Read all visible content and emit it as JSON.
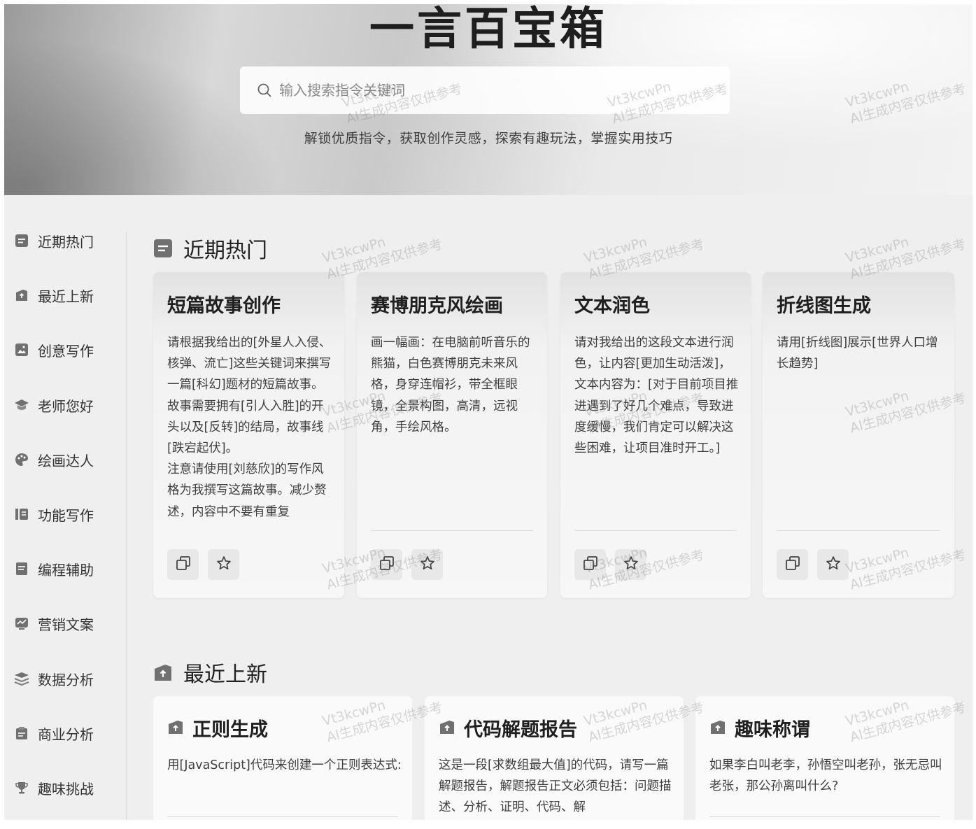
{
  "hero": {
    "title": "一言百宝箱",
    "search_placeholder": "输入搜索指令关键词",
    "tagline": "解锁优质指令，获取创作灵感，探索有趣玩法，掌握实用技巧"
  },
  "sidebar": {
    "items": [
      {
        "label": "近期热门",
        "icon": "list-icon"
      },
      {
        "label": "最近上新",
        "icon": "new-box-icon"
      },
      {
        "label": "创意写作",
        "icon": "image-icon"
      },
      {
        "label": "老师您好",
        "icon": "graduation-cap-icon"
      },
      {
        "label": "绘画达人",
        "icon": "palette-icon"
      },
      {
        "label": "功能写作",
        "icon": "document-icon"
      },
      {
        "label": "编程辅助",
        "icon": "code-list-icon"
      },
      {
        "label": "营销文案",
        "icon": "chart-screen-icon"
      },
      {
        "label": "数据分析",
        "icon": "layers-icon"
      },
      {
        "label": "商业分析",
        "icon": "clipboard-icon"
      },
      {
        "label": "趣味挑战",
        "icon": "trophy-icon"
      }
    ]
  },
  "sections": {
    "hot": {
      "title": "近期热门"
    },
    "new": {
      "title": "最近上新"
    }
  },
  "hot_cards": [
    {
      "title": "短篇故事创作",
      "desc": "请根据我给出的[外星人入侵、核弹、流亡]这些关键词来撰写一篇[科幻]题材的短篇故事。\n故事需要拥有[引人入胜]的开头以及[反转]的结局，故事线[跌宕起伏]。\n注意请使用[刘慈欣]的写作风格为我撰写这篇故事。减少赘述，内容中不要有重复"
    },
    {
      "title": "赛博朋克风绘画",
      "desc": "画一幅画：在电脑前听音乐的熊猫，白色赛博朋克未来风格，身穿连帽衫，带全框眼镜，全景构图，高清，远视角，手绘风格。"
    },
    {
      "title": "文本润色",
      "desc": "请对我给出的这段文本进行润色，让内容[更加生动活泼]，文本内容为：[对于目前项目推进遇到了好几个难点，导致进度缓慢，我们肯定可以解决这些困难，让项目准时开工。]"
    },
    {
      "title": "折线图生成",
      "desc": "请用[折线图]展示[世界人口增长趋势]"
    }
  ],
  "new_cards": [
    {
      "title": "正则生成",
      "desc": "用[JavaScript]代码来创建一个正则表达式:"
    },
    {
      "title": "代码解题报告",
      "desc": "这是一段[求数组最大值]的代码，请写一篇解题报告，解题报告正文必须包括：问题描述、分析、证明、代码、解"
    },
    {
      "title": "趣味称谓",
      "desc": "如果李白叫老李，孙悟空叫老孙，张无忌叫老张，那公孙离叫什么?"
    }
  ],
  "watermark": {
    "line1": "Vt3kcwPn",
    "line2": "AI生成内容仅供参考"
  }
}
